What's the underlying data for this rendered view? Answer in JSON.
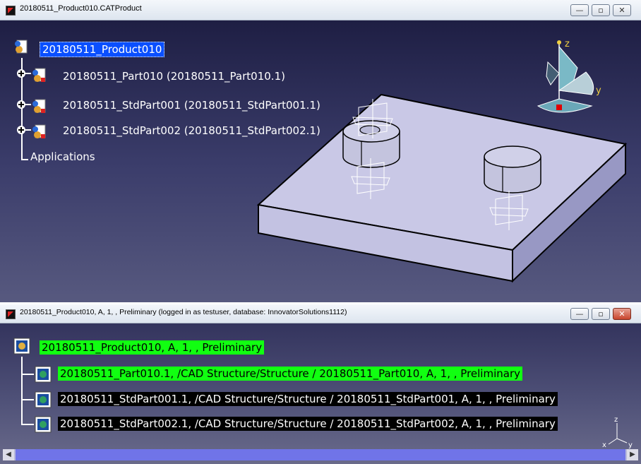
{
  "window_top": {
    "title": "20180511_Product010.CATProduct",
    "tree": {
      "root": "20180511_Product010",
      "children": [
        "20180511_Part010 (20180511_Part010.1)",
        "20180511_StdPart001 (20180511_StdPart001.1)",
        "20180511_StdPart002 (20180511_StdPart002.1)"
      ],
      "applications": "Applications"
    },
    "compass_axes": {
      "z": "z",
      "y": "y"
    }
  },
  "window_bottom": {
    "title": "20180511_Product010, A, 1, , Preliminary (logged in as testuser, database: InnovatorSolutions1112)",
    "tree": {
      "root": "20180511_Product010, A, 1, , Preliminary",
      "children": [
        "20180511_Part010.1, /CAD Structure/Structure / 20180511_Part010, A, 1, , Preliminary",
        "20180511_StdPart001.1, /CAD Structure/Structure / 20180511_StdPart001, A, 1, , Preliminary",
        "20180511_StdPart002.1, /CAD Structure/Structure / 20180511_StdPart002, A, 1, , Preliminary"
      ]
    },
    "axis_triad": {
      "x": "x",
      "y": "y",
      "z": "z"
    }
  },
  "window_buttons": {
    "minimize": "—",
    "maximize": "▫",
    "close": "✕"
  },
  "colors": {
    "selected": "#0a4fff",
    "highlight_green": "#11ff11",
    "viewport_bg": "#3b3d6b",
    "plate": "#c8c8e4"
  }
}
